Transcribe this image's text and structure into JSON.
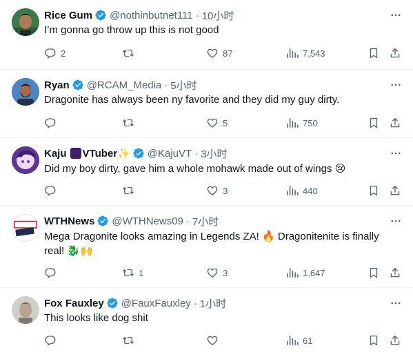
{
  "tweets": [
    {
      "name": "Rice Gum",
      "handle": "@nothinbutnet111",
      "time": "10小时",
      "text": "I’m gonna go throw up this is not good",
      "replies": "2",
      "reposts": "",
      "likes": "87",
      "views": "7,543"
    },
    {
      "name": "Ryan",
      "handle": "@RCAM_Media",
      "time": "5小时",
      "text": "Dragonite has always been ny favorite and they did my guy dirty.",
      "replies": "",
      "reposts": "",
      "likes": "5",
      "views": "750"
    },
    {
      "name": "Kaju",
      "name_suffix": "VTuber",
      "sparkle": "✨",
      "handle": "@KajuVT",
      "time": "3小时",
      "text": "Did my boy dirty, gave him a whole mohawk made out of wings",
      "text_emoji": "😢",
      "replies": "",
      "reposts": "",
      "likes": "3",
      "views": "440"
    },
    {
      "name": "WTHNews",
      "handle": "@WTHNews09",
      "time": "7小时",
      "text_line1": "Mega Dragonite looks amazing in Legends ZA!",
      "fire": "🔥",
      "text_line1b": "Dragonitenite is finally",
      "text_line2": "real!",
      "text_emoji2": "🐉🙌",
      "replies": "",
      "reposts": "1",
      "likes": "3",
      "views": "1,647",
      "avatar_label_top": "WTH",
      "avatar_label_bottom": "NEWS"
    },
    {
      "name": "Fox Fauxley",
      "handle": "@FauxFauxley",
      "time": "1小时",
      "text": "This looks like dog shit",
      "replies": "",
      "reposts": "",
      "likes": "",
      "views": "61"
    }
  ],
  "colors": {
    "verified": "#1d9bf0",
    "secondary_text": "#536471",
    "divider": "#eff3f4"
  },
  "icons": [
    "reply-icon",
    "repost-icon",
    "like-icon",
    "views-icon",
    "bookmark-icon",
    "share-icon",
    "more-icon",
    "verified-badge-icon"
  ]
}
